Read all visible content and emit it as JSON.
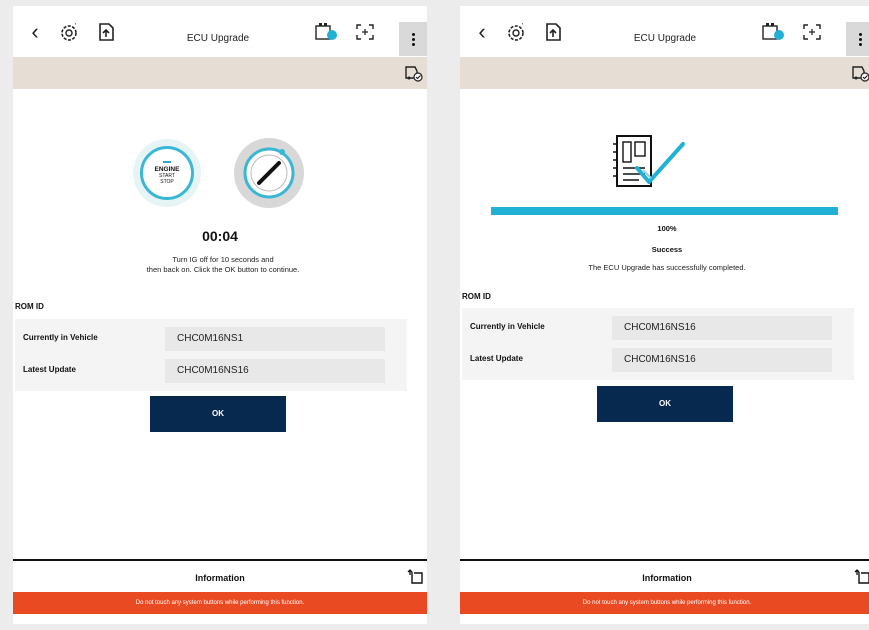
{
  "screens": [
    {
      "header": {
        "title": "ECU Upgrade"
      },
      "timer": "00:04",
      "instruction": {
        "line1": "Turn IG off for 10 seconds and",
        "line2": "then back on. Click the OK button to continue."
      },
      "engine_button": {
        "line1": "ENGINE",
        "line2": "START",
        "line3": "STOP"
      },
      "rom": {
        "label": "ROM ID",
        "rows": [
          {
            "key": "Currently in Vehicle",
            "value": "CHC0M16NS1"
          },
          {
            "key": "Latest Update",
            "value": "CHC0M16NS16"
          }
        ]
      },
      "ok_label": "OK",
      "info_label": "Information",
      "warning": "Do not touch any system buttons while performing this function."
    },
    {
      "header": {
        "title": "ECU Upgrade"
      },
      "progress": {
        "percent": 100,
        "label": "100%"
      },
      "status": "Success",
      "status_message": "The ECU Upgrade has successfully completed.",
      "rom": {
        "label": "ROM ID",
        "rows": [
          {
            "key": "Currently in Vehicle",
            "value": "CHC0M16NS16"
          },
          {
            "key": "Latest Update",
            "value": "CHC0M16NS16"
          }
        ]
      },
      "ok_label": "OK",
      "info_label": "Information",
      "warning": "Do not touch any system buttons while performing this function."
    }
  ],
  "colors": {
    "accent": "#21b1d4",
    "primary_button": "#07284f",
    "warning": "#e94a22",
    "subbar": "#e6ddd5"
  },
  "icons": {
    "back": "back-chevron-icon",
    "settings": "gear-settings-icon",
    "doc": "document-upload-icon",
    "battery": "battery-icon",
    "fullscreen": "fullscreen-icon",
    "menu": "kebab-menu-icon",
    "vehicle": "vehicle-check-icon",
    "expand": "expand-icon"
  }
}
